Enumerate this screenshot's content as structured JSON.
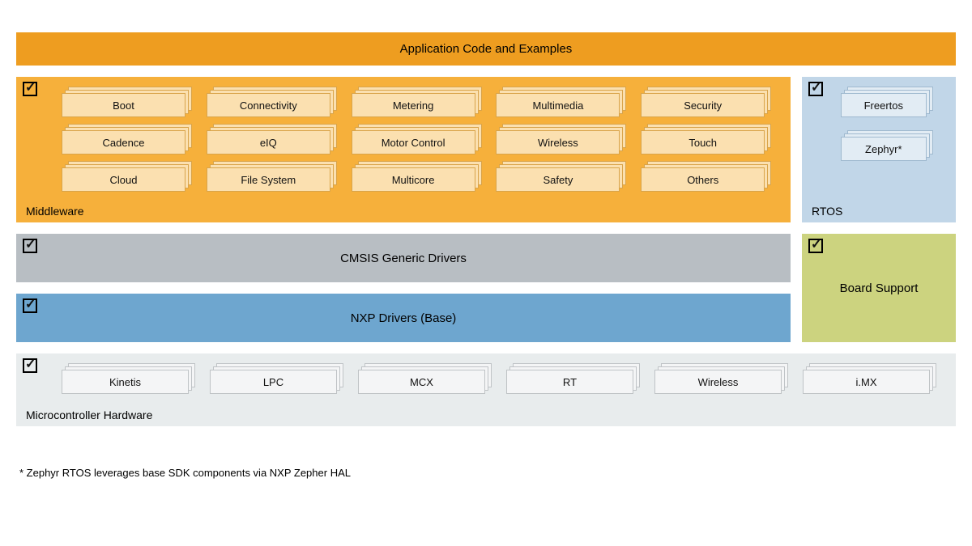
{
  "top_banner": "Application Code and Examples",
  "middleware": {
    "label": "Middleware",
    "items": [
      "Boot",
      "Connectivity",
      "Metering",
      "Multimedia",
      "Security",
      "Cadence",
      "eIQ",
      "Motor Control",
      "Wireless",
      "Touch",
      "Cloud",
      "File System",
      "Multicore",
      "Safety",
      "Others"
    ]
  },
  "rtos": {
    "label": "RTOS",
    "items": [
      "Freertos",
      "Zephyr*"
    ]
  },
  "cmsis": "CMSIS Generic Drivers",
  "nxp_drivers": "NXP Drivers (Base)",
  "board_support": "Board Support",
  "hardware": {
    "label": "Microcontroller Hardware",
    "items": [
      "Kinetis",
      "LPC",
      "MCX",
      "RT",
      "Wireless",
      "i.MX"
    ]
  },
  "footnote": "* Zephyr RTOS leverages base SDK components via NXP Zepher HAL"
}
